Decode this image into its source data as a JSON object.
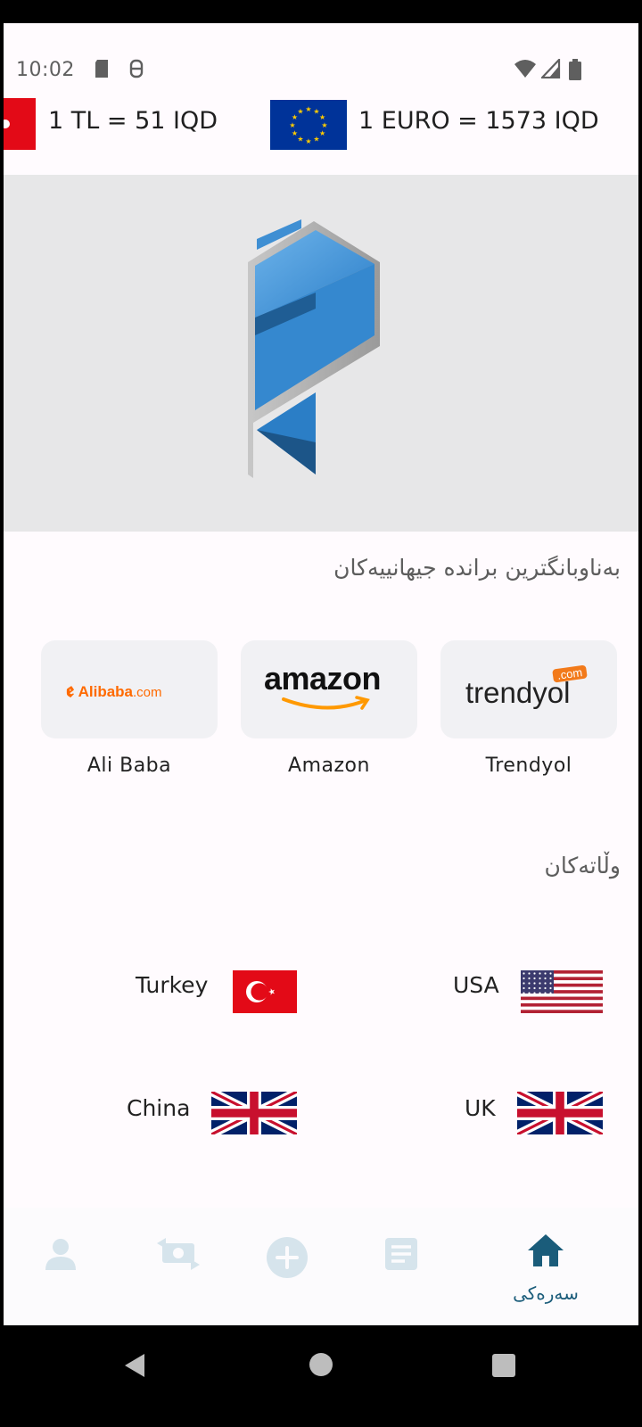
{
  "status_bar": {
    "time": "10:02"
  },
  "ticker": {
    "items": [
      {
        "text": "1 TL =  51 IQD",
        "flag": "turkey-flag"
      },
      {
        "text": "1 EURO =  1573 IQD",
        "flag": "eu-flag"
      }
    ]
  },
  "brands": {
    "title": "بەناوبانگترین براندە جیهانییەکان",
    "items": [
      {
        "name": "Ali Baba",
        "logo_text": "Alibaba",
        "logo_suffix": ".com",
        "logo_color": "#ff6a00"
      },
      {
        "name": "Amazon",
        "logo_text": "amazon",
        "logo_color": "#111111",
        "accent": "#ff9900"
      },
      {
        "name": "Trendyol",
        "logo_text": "trendyol",
        "logo_badge": ".com",
        "logo_color": "#222222",
        "accent": "#f27a1a"
      }
    ]
  },
  "countries": {
    "title": "وڵاتەکان",
    "items": [
      {
        "name": "Turkey",
        "flag": "turkey-flag"
      },
      {
        "name": "USA",
        "flag": "usa-flag"
      },
      {
        "name": "China",
        "flag": "uk-flag"
      },
      {
        "name": "UK",
        "flag": "uk-flag"
      }
    ]
  },
  "bottom_nav": {
    "items": [
      {
        "icon": "person-icon",
        "active": false
      },
      {
        "icon": "money-exchange-icon",
        "active": false
      },
      {
        "icon": "add-circle-icon",
        "active": false
      },
      {
        "icon": "document-icon",
        "active": false
      },
      {
        "icon": "home-icon",
        "label": "سەرەکی",
        "active": true
      }
    ]
  },
  "colors": {
    "accent": "#1a5c7a",
    "inactive_icon": "#d6e4ec",
    "banner_bg": "#e7e7e8",
    "card_bg": "#f1f1f4"
  }
}
